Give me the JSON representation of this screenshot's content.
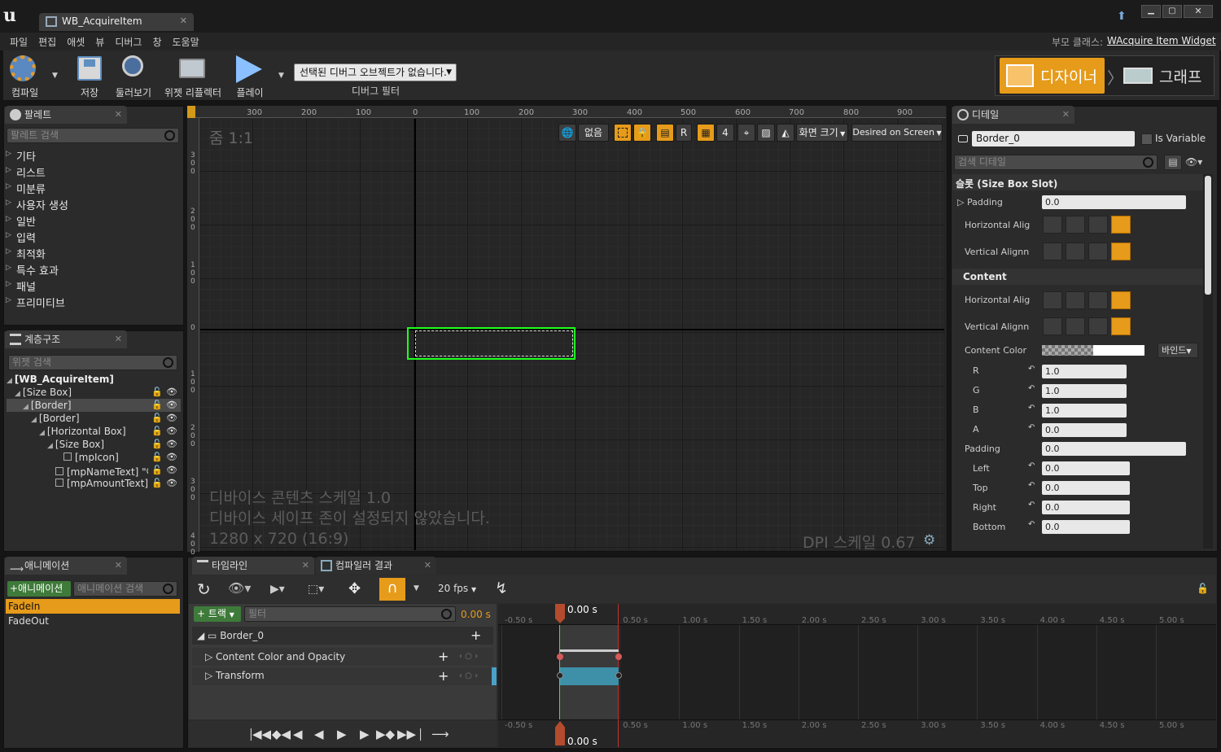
{
  "colors": {
    "accent": "#e69b1a",
    "selection": "#1eff1e",
    "bg": "#151515",
    "panel": "#2b2b2b"
  },
  "window": {
    "tab_title": "WB_AcquireItem",
    "parent_class_label": "부모 클래스:",
    "parent_class_value": "WAcquire Item Widget"
  },
  "menu": [
    "파일",
    "편집",
    "애셋",
    "뷰",
    "디버그",
    "창",
    "도움말"
  ],
  "toolbar": {
    "compile": "컴파일",
    "save": "저장",
    "browse": "둘러보기",
    "widget_reflector": "위젯 리플렉터",
    "play": "플레이",
    "debug_select": "선택된 디버그 오브젝트가 없습니다.",
    "debug_filter": "디버그 필터",
    "designer": "디자이너",
    "graph": "그래프"
  },
  "palette": {
    "title": "팔레트",
    "search_placeholder": "팔레트 검색",
    "items": [
      "기타",
      "리스트",
      "미분류",
      "사용자 생성",
      "일반",
      "입력",
      "최적화",
      "특수 효과",
      "패널",
      "프리미티브"
    ]
  },
  "hierarchy": {
    "title": "계층구조",
    "search_placeholder": "위젯 검색",
    "nodes": [
      "[WB_AcquireItem]",
      "[Size Box]",
      "[Border]",
      "[Border]",
      "[Horizontal Box]",
      "[Size Box]",
      "[mpIcon]",
      "[mpNameText] \"아(",
      "[mpAmountText] \"("
    ]
  },
  "viewport": {
    "zoom": "줌 1:1",
    "none_btn": "없음",
    "r_btn": "R",
    "grid_num": "4",
    "screen_size": "화면 크기",
    "desired": "Desired on Screen",
    "info_lines": [
      "디바이스 콘텐츠 스케일 1.0",
      "디바이스 세이프 존이 설정되지 않았습니다.",
      "1280 x 720 (16:9)"
    ],
    "dpi": "DPI 스케일 0.67",
    "h_ruler": [
      "300",
      "200",
      "100",
      "0",
      "100",
      "200",
      "300",
      "400",
      "500",
      "600",
      "700",
      "800",
      "900"
    ],
    "v_ruler": [
      "300",
      "200",
      "100",
      "0",
      "100",
      "200",
      "300",
      "400"
    ]
  },
  "details": {
    "title": "디테일",
    "name": "Border_0",
    "is_variable": "Is Variable",
    "search_placeholder": "검색 디테일",
    "slot_section": "슬롯 (Size Box Slot)",
    "padding": "Padding",
    "padding_value": "0.0",
    "h_align": "Horizontal Alig",
    "v_align": "Vertical Alignn",
    "content_section": "Content",
    "content_color": "Content Color",
    "bind": "바인드",
    "rgba": [
      {
        "label": "R",
        "value": "1.0"
      },
      {
        "label": "G",
        "value": "1.0"
      },
      {
        "label": "B",
        "value": "1.0"
      },
      {
        "label": "A",
        "value": "0.0"
      }
    ],
    "padding2": "Padding",
    "padding2_value": "0.0",
    "sides": [
      {
        "label": "Left",
        "value": "0.0"
      },
      {
        "label": "Top",
        "value": "0.0"
      },
      {
        "label": "Right",
        "value": "0.0"
      },
      {
        "label": "Bottom",
        "value": "0.0"
      }
    ]
  },
  "animations": {
    "title": "애니메이션",
    "add_btn": "+애니메이션",
    "search_placeholder": "애니메이션 검색",
    "items": [
      "FadeIn",
      "FadeOut"
    ],
    "selected": "FadeIn"
  },
  "timeline": {
    "tab": "타임라인",
    "compiler_tab": "컴파일러 결과",
    "fps": "20 fps",
    "track_btn": "+ 트랙",
    "filter_placeholder": "필터",
    "time": "0.00 s",
    "object": "Border_0",
    "tracks": [
      "Content Color and Opacity",
      "Transform"
    ],
    "ticks": [
      "-0.50 s",
      "0.00 s",
      "0.50 s",
      "1.00 s",
      "1.50 s",
      "2.00 s",
      "2.50 s",
      "3.00 s",
      "3.50 s",
      "4.00 s",
      "4.50 s",
      "5.00 s"
    ],
    "cursor_time": "0.00 s"
  }
}
